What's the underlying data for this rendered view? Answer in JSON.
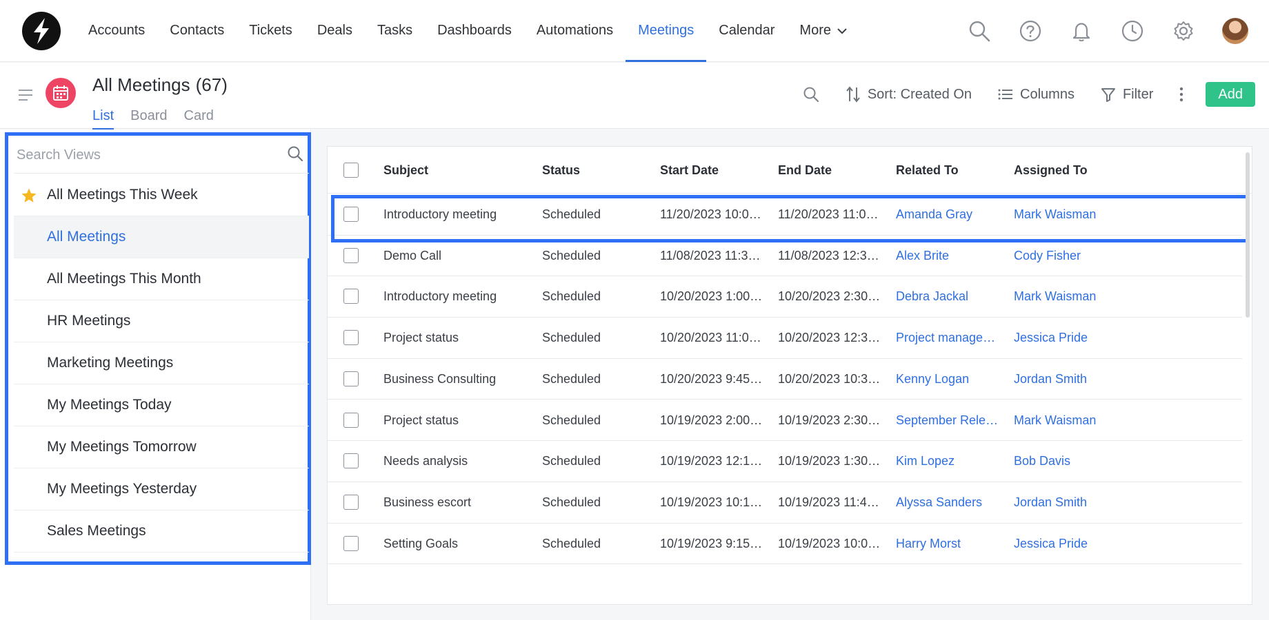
{
  "nav": {
    "items": [
      "Accounts",
      "Contacts",
      "Tickets",
      "Deals",
      "Tasks",
      "Dashboards",
      "Automations",
      "Meetings",
      "Calendar",
      "More"
    ],
    "active": "Meetings",
    "icons": [
      "search-icon",
      "help-icon",
      "bell-icon",
      "clock-icon",
      "gear-icon",
      "avatar"
    ]
  },
  "header": {
    "title": "All Meetings",
    "count": "(67)",
    "tabs": [
      "List",
      "Board",
      "Card"
    ],
    "active_tab": "List"
  },
  "toolbar": {
    "sort_label": "Sort: Created On",
    "columns_label": "Columns",
    "filter_label": "Filter",
    "add_label": "Add"
  },
  "sidebar": {
    "search_placeholder": "Search Views",
    "views": [
      {
        "label": "All Meetings This Week",
        "starred": true
      },
      {
        "label": "All Meetings",
        "active": true
      },
      {
        "label": "All Meetings This Month"
      },
      {
        "label": "HR Meetings"
      },
      {
        "label": "Marketing Meetings"
      },
      {
        "label": "My Meetings Today"
      },
      {
        "label": "My Meetings Tomorrow"
      },
      {
        "label": "My Meetings Yesterday"
      },
      {
        "label": "Sales Meetings"
      }
    ]
  },
  "table": {
    "columns": [
      "Subject",
      "Status",
      "Start Date",
      "End Date",
      "Related To",
      "Assigned To"
    ],
    "rows": [
      [
        "Introductory meeting",
        "Scheduled",
        "11/20/2023 10:00 …",
        "11/20/2023 11:00 …",
        "Amanda Gray",
        "Mark Waisman"
      ],
      [
        "Demo Call",
        "Scheduled",
        "11/08/2023 11:33 …",
        "11/08/2023 12:33 …",
        "Alex Brite",
        "Cody Fisher"
      ],
      [
        "Introductory meeting",
        "Scheduled",
        "10/20/2023 1:00 PM",
        "10/20/2023 2:30 PM",
        "Debra Jackal",
        "Mark Waisman"
      ],
      [
        "Project status",
        "Scheduled",
        "10/20/2023 11:00 …",
        "10/20/2023 12:30 …",
        "Project managem…",
        "Jessica Pride"
      ],
      [
        "Business Consulting",
        "Scheduled",
        "10/20/2023 9:45 AM",
        "10/20/2023 10:30 …",
        "Kenny Logan",
        "Jordan Smith"
      ],
      [
        "Project status",
        "Scheduled",
        "10/19/2023 2:00 PM",
        "10/19/2023 2:30 PM",
        "September Relea…",
        "Mark Waisman"
      ],
      [
        "Needs analysis",
        "Scheduled",
        "10/19/2023 12:15 …",
        "10/19/2023 1:30 PM",
        "Kim Lopez",
        "Bob Davis"
      ],
      [
        "Business escort",
        "Scheduled",
        "10/19/2023 10:15 …",
        "10/19/2023 11:45 …",
        "Alyssa Sanders",
        "Jordan Smith"
      ],
      [
        "Setting Goals",
        "Scheduled",
        "10/19/2023 9:15 AM",
        "10/19/2023 10:00 …",
        "Harry Morst",
        "Jessica Pride"
      ]
    ]
  },
  "colors": {
    "accent": "#2f6fe0",
    "add_button": "#2fc38a",
    "module_icon": "#ef4565",
    "highlight_frame": "#2f6ff5"
  }
}
